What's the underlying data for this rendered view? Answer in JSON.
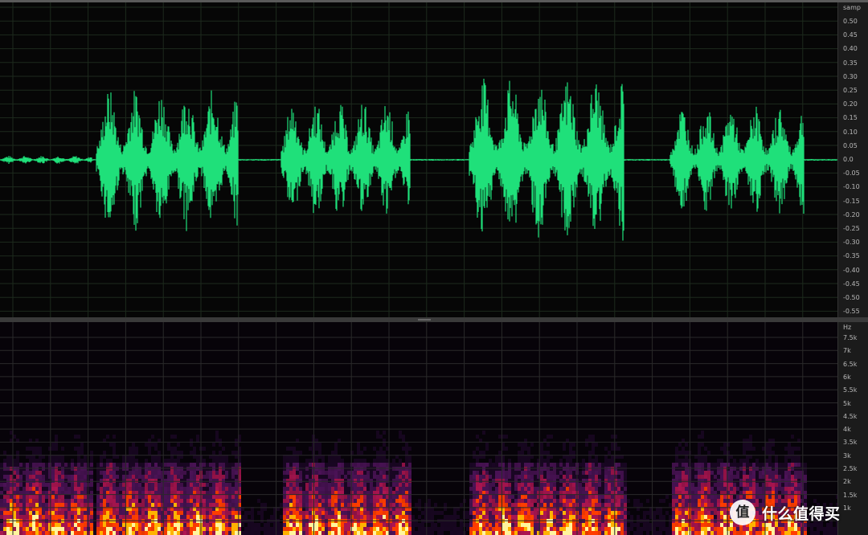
{
  "waveform": {
    "unit": "samp",
    "ticks": [
      "0.50",
      "0.45",
      "0.40",
      "0.35",
      "0.30",
      "0.25",
      "0.20",
      "0.15",
      "0.10",
      "0.05",
      "0.0",
      "-0.05",
      "-0.10",
      "-0.15",
      "-0.20",
      "-0.25",
      "-0.30",
      "-0.35",
      "-0.40",
      "-0.45",
      "-0.50",
      "-0.55"
    ],
    "color": "#1fe07a",
    "bursts": [
      {
        "start": 0.0,
        "end": 0.11,
        "amp": 0.015
      },
      {
        "start": 0.115,
        "end": 0.285,
        "amp": 0.26
      },
      {
        "start": 0.335,
        "end": 0.49,
        "amp": 0.22
      },
      {
        "start": 0.56,
        "end": 0.745,
        "amp": 0.3
      },
      {
        "start": 0.8,
        "end": 0.96,
        "amp": 0.2
      }
    ]
  },
  "spectrogram": {
    "unit": "Hz",
    "ticks": [
      "7.5k",
      "7k",
      "6.5k",
      "6k",
      "5.5k",
      "5k",
      "4.5k",
      "4k",
      "3.5k",
      "3k",
      "2.5k",
      "2k",
      "1.5k",
      "1k"
    ],
    "colors": [
      "#2a0a3a",
      "#6a1a7a",
      "#c2185b",
      "#ff3d00",
      "#ffb300",
      "#fff59d"
    ]
  },
  "watermark": {
    "logo_glyph": "值",
    "text": "什么值得买"
  }
}
